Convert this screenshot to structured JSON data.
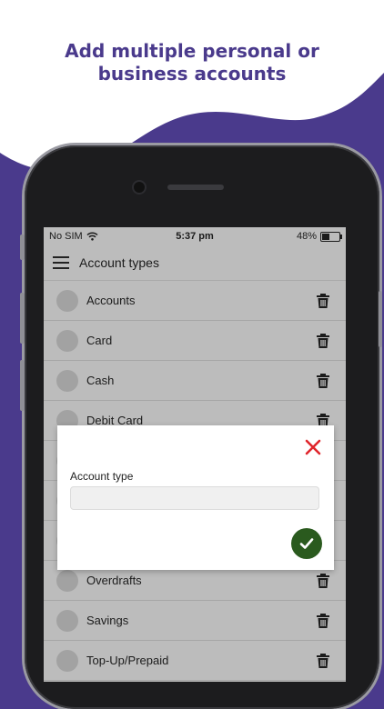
{
  "headline": {
    "line1": "Add multiple personal or",
    "line2": "business accounts"
  },
  "colors": {
    "background_purple": "#4a3a8c",
    "screen_dim": "#bcbcbc",
    "close_red": "#e0252b",
    "confirm_green": "#2a5a1e"
  },
  "status_bar": {
    "carrier": "No SIM",
    "time": "5:37 pm",
    "battery_text": "48%",
    "battery_level": 0.48
  },
  "app_bar": {
    "menu_icon": "hamburger-icon",
    "title": "Account types"
  },
  "account_types": [
    {
      "label": "Accounts"
    },
    {
      "label": "Card"
    },
    {
      "label": "Cash"
    },
    {
      "label": "Debit Card"
    },
    {
      "label": ""
    },
    {
      "label": ""
    },
    {
      "label": ""
    },
    {
      "label": "Overdrafts"
    },
    {
      "label": "Savings"
    },
    {
      "label": "Top-Up/Prepaid"
    }
  ],
  "dialog": {
    "field_label": "Account type",
    "field_value": "",
    "field_placeholder": "",
    "close_icon": "close-icon",
    "confirm_icon": "checkmark-icon"
  }
}
